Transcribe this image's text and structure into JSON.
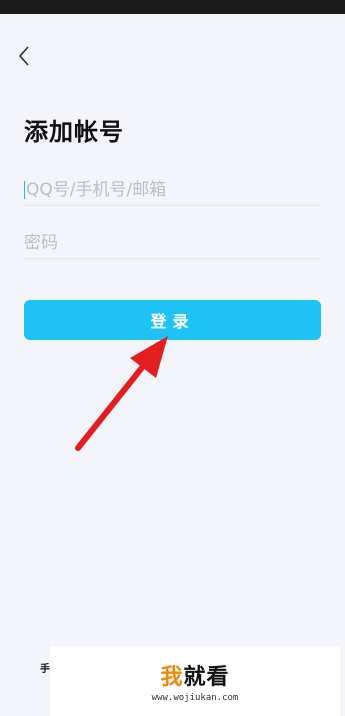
{
  "header": {
    "back_icon": "chevron-left-icon"
  },
  "page": {
    "title": "添加帐号"
  },
  "form": {
    "account_placeholder": "QQ号/手机号/邮箱",
    "account_value": "",
    "password_placeholder": "密码",
    "password_value": "",
    "login_label": "登录"
  },
  "footer": {
    "hint_char": "手"
  },
  "watermark": {
    "brand_prefix": "我",
    "brand_suffix": "就看",
    "url": "www.wojiukan.com"
  },
  "colors": {
    "accent": "#1ec2f4",
    "background": "#f3f5fa",
    "annotation_arrow": "#e41e20"
  }
}
